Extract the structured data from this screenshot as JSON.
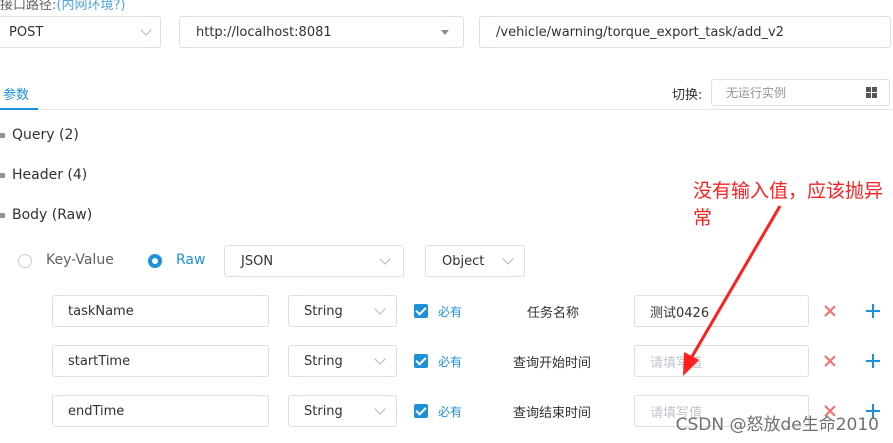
{
  "top": {
    "label_prefix": "接口路径:",
    "label_hint": "(内网环境?)",
    "method": "POST",
    "host": "http://localhost:8081",
    "path": "/vehicle/warning/torque_export_task/add_v2"
  },
  "tabs": {
    "params": "参数",
    "switch_label": "切换:",
    "switch_value": "无运行实例"
  },
  "sections": {
    "query": "Query (2)",
    "header": "Header (4)",
    "body": "Body (Raw)"
  },
  "body_options": {
    "key_value": "Key-Value",
    "raw": "Raw",
    "format": "JSON",
    "root_type": "Object"
  },
  "fields": [
    {
      "name": "taskName",
      "type": "String",
      "required": "必有",
      "desc": "任务名称",
      "value": "测试0426",
      "placeholder": ""
    },
    {
      "name": "startTime",
      "type": "String",
      "required": "必有",
      "desc": "查询开始时间",
      "value": "",
      "placeholder": "请填写值"
    },
    {
      "name": "endTime",
      "type": "String",
      "required": "必有",
      "desc": "查询结束时间",
      "value": "",
      "placeholder": "请填写值"
    }
  ],
  "annotation": {
    "text": "没有输入值，应该抛异常",
    "color": "#ff1f1f"
  },
  "watermark": "CSDN @怒放de生命2010",
  "colors": {
    "accent": "#1e90d6",
    "danger": "#f56c6c",
    "border": "#dcdfe6"
  }
}
